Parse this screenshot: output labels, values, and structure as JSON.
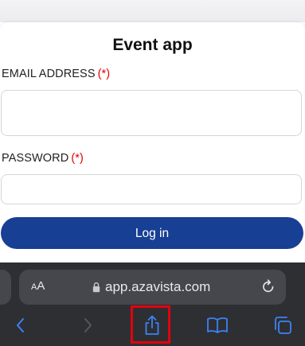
{
  "page": {
    "title": "Event app"
  },
  "form": {
    "email_label": "EMAIL ADDRESS",
    "email_required": "(*)",
    "email_value": "",
    "password_label": "PASSWORD",
    "password_required": "(*)",
    "password_value": "",
    "login_button": "Log in"
  },
  "browser": {
    "text_size_small": "A",
    "text_size_large": "A",
    "url": "app.azavista.com",
    "icons": {
      "lock": "lock-icon",
      "reload": "reload-icon",
      "back": "chevron-left-icon",
      "forward": "chevron-right-icon",
      "share": "share-icon",
      "bookmarks": "book-icon",
      "tabs": "tabs-icon"
    }
  },
  "colors": {
    "primary_button": "#173f94",
    "required": "#e00000",
    "toolbar_accent": "#3b82f6",
    "highlight": "#e3000f"
  }
}
